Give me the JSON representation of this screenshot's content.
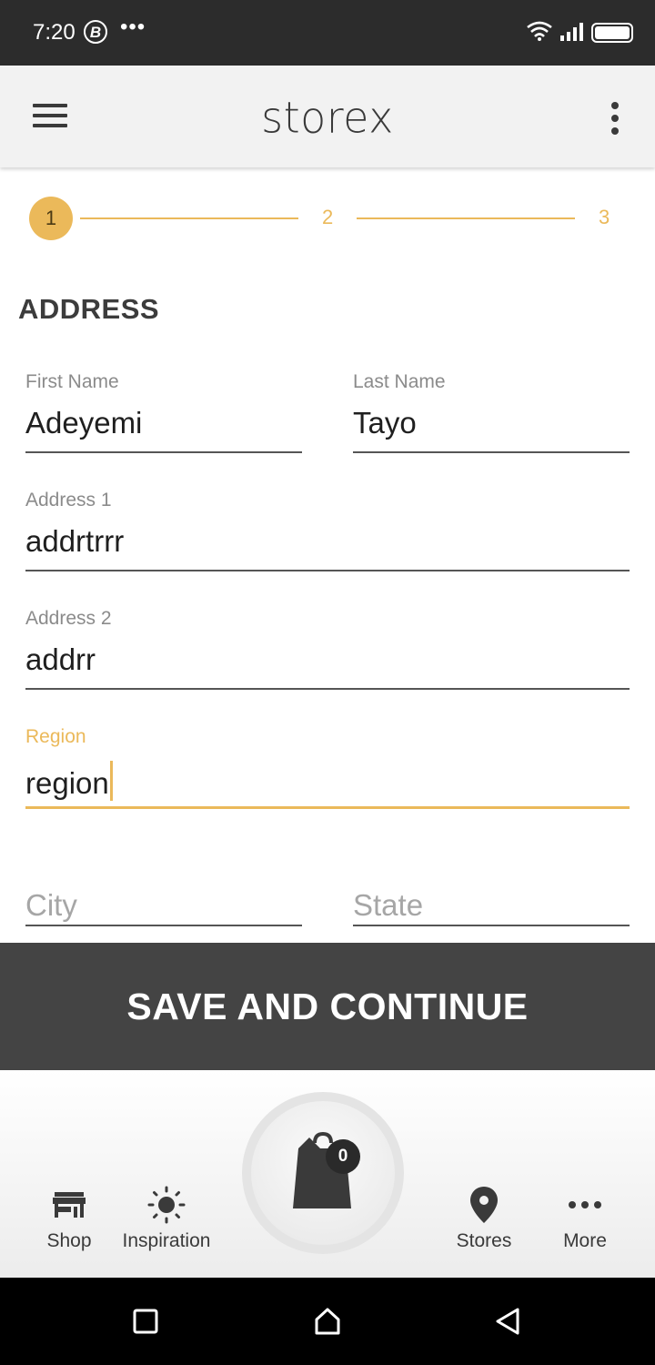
{
  "status_bar": {
    "time": "7:20",
    "notification_icon": "B",
    "more_indicator": "•••"
  },
  "app_bar": {
    "title": "storex",
    "menu_icon": "hamburger-menu-icon",
    "overflow_icon": "more-vertical-icon"
  },
  "stepper": {
    "steps": [
      "1",
      "2",
      "3"
    ],
    "active_step": 1,
    "accent_color": "#ebb95a"
  },
  "form": {
    "section_title": "ADDRESS",
    "first_name": {
      "label": "First Name",
      "value": "Adeyemi"
    },
    "last_name": {
      "label": "Last Name",
      "value": "Tayo"
    },
    "address1": {
      "label": "Address 1",
      "value": "addrtrrr"
    },
    "address2": {
      "label": "Address 2",
      "value": "addrr"
    },
    "region": {
      "label": "Region",
      "value": "region"
    },
    "city": {
      "placeholder": "City"
    },
    "state": {
      "placeholder": "State"
    }
  },
  "save_button": {
    "label": "SAVE AND CONTINUE"
  },
  "bottom_nav": {
    "items": [
      {
        "label": "Shop",
        "icon": "store-icon"
      },
      {
        "label": "Inspiration",
        "icon": "sun-icon"
      },
      {
        "label": "Stores",
        "icon": "location-pin-icon"
      },
      {
        "label": "More",
        "icon": "more-horizontal-icon"
      }
    ],
    "cart": {
      "icon": "shopping-bag-icon",
      "count": "0"
    }
  },
  "colors": {
    "accent": "#ebb95a",
    "button_bg": "#444444",
    "status_bar_bg": "#2c2c2c"
  }
}
